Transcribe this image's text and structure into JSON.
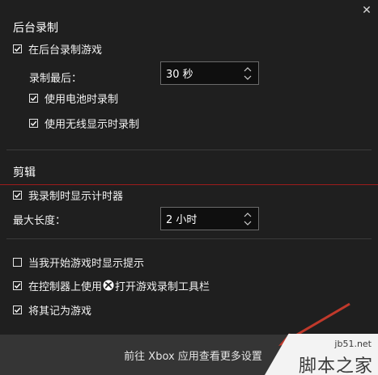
{
  "background_recording": {
    "title": "后台录制",
    "record_in_background": {
      "label": "在后台录制游戏",
      "checked": true
    },
    "record_last_label": "录制最后：",
    "record_last_select": {
      "value": "30 秒"
    },
    "battery": {
      "label": "使用电池时录制",
      "checked": true
    },
    "wireless": {
      "label": "使用无线显示时录制",
      "checked": true
    }
  },
  "clips": {
    "title": "剪辑",
    "show_timer": {
      "label": "我录制时显示计时器",
      "checked": true
    },
    "max_length_label": "最大长度：",
    "max_length_select": {
      "value": "2 小时"
    }
  },
  "options": {
    "show_tips": {
      "label": "当我开始游戏时显示提示",
      "checked": false
    },
    "controller_before": "在控制器上使用",
    "controller_after": "打开游戏录制工具栏",
    "controller_checked": true,
    "remember_game": {
      "label": "将其记为游戏",
      "checked": true
    }
  },
  "footer": {
    "link": "前往 Xbox 应用查看更多设置"
  },
  "watermark": {
    "line1": "jb51.net",
    "line2": "脚本之家"
  },
  "colors": {
    "background": "#1f1f1f",
    "footer": "#353535",
    "annotation_red": "#c0392b"
  }
}
